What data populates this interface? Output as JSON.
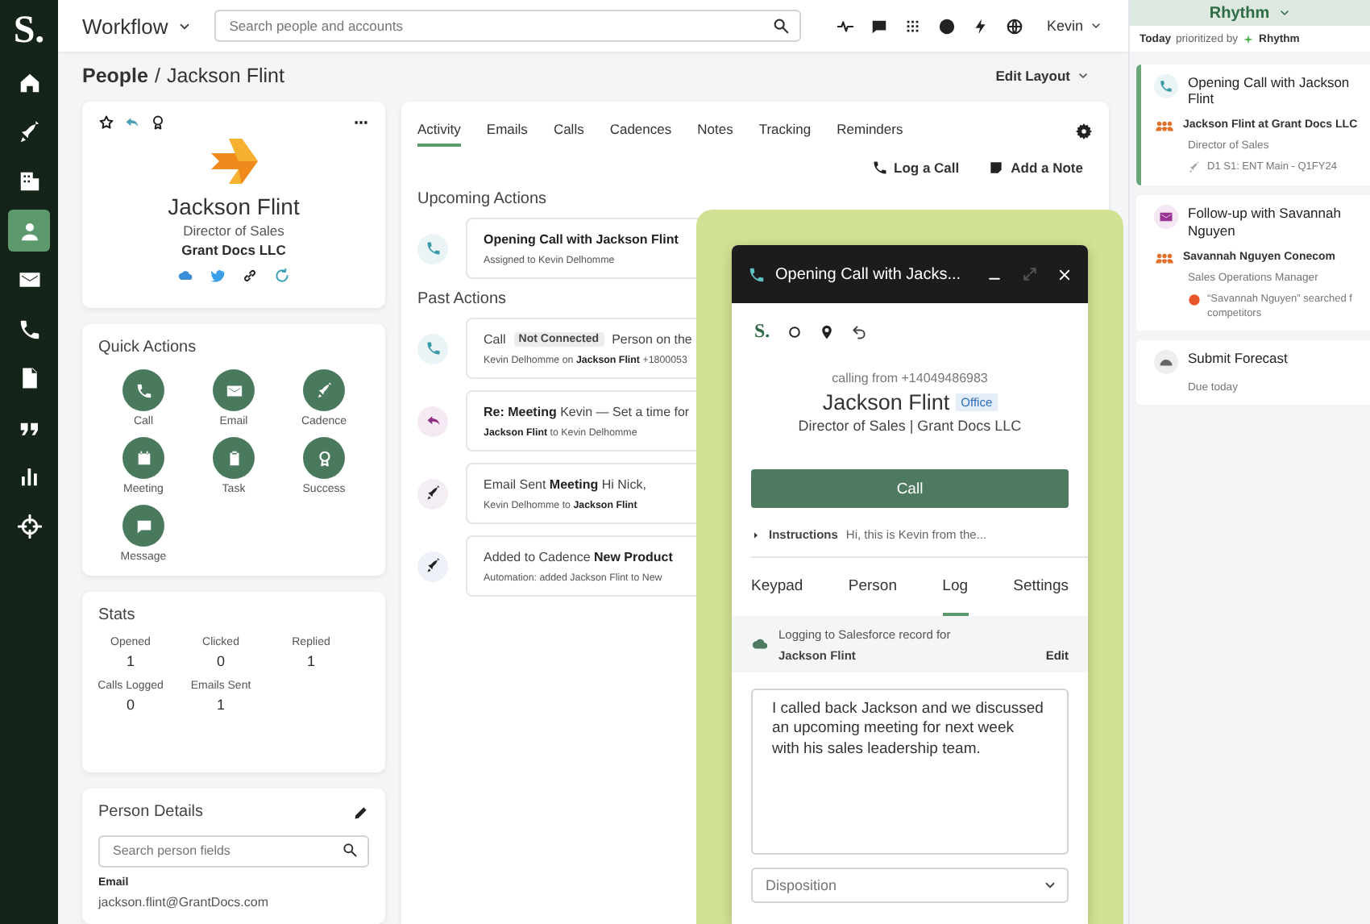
{
  "sidebar": {
    "logo": "S.",
    "items": [
      {
        "kind": "home",
        "selected": false
      },
      {
        "kind": "rocket",
        "selected": false
      },
      {
        "kind": "building",
        "selected": false
      },
      {
        "kind": "person",
        "selected": true
      },
      {
        "kind": "mail",
        "selected": false
      },
      {
        "kind": "phone",
        "selected": false
      },
      {
        "kind": "doc",
        "selected": false
      },
      {
        "kind": "quote",
        "selected": false
      },
      {
        "kind": "chart",
        "selected": false
      },
      {
        "kind": "target",
        "selected": false
      }
    ]
  },
  "topbar": {
    "title": "Workflow",
    "search": {
      "placeholder": "Search people and accounts"
    },
    "user": "Kevin"
  },
  "breadcrumb": {
    "section": "People",
    "separator": "/",
    "current": "Jackson Flint"
  },
  "edit_layout": "Edit Layout",
  "profile": {
    "name": "Jackson Flint",
    "title": "Director of Sales",
    "company": "Grant Docs LLC"
  },
  "quick_actions": {
    "title": "Quick Actions",
    "items": [
      {
        "kind": "phone",
        "label": "Call"
      },
      {
        "kind": "mail",
        "label": "Email"
      },
      {
        "kind": "rocket",
        "label": "Cadence"
      },
      {
        "kind": "calendar",
        "label": "Meeting"
      },
      {
        "kind": "clipboard",
        "label": "Task"
      },
      {
        "kind": "award",
        "label": "Success"
      },
      {
        "kind": "chat",
        "label": "Message"
      }
    ]
  },
  "stats": {
    "title": "Stats",
    "items": [
      {
        "label": "Opened",
        "value": "1"
      },
      {
        "label": "Clicked",
        "value": "0"
      },
      {
        "label": "Replied",
        "value": "1"
      },
      {
        "label": "Calls Logged",
        "value": "0"
      },
      {
        "label": "Emails Sent",
        "value": "1"
      }
    ]
  },
  "person_details": {
    "title": "Person Details",
    "search": {
      "placeholder": "Search person fields"
    },
    "field_label": "Email",
    "field_value": "jackson.flint@GrantDocs.com"
  },
  "activity": {
    "tabs": [
      {
        "label": "Activity",
        "selected": true
      },
      {
        "label": "Emails",
        "selected": false
      },
      {
        "label": "Calls",
        "selected": false
      },
      {
        "label": "Cadences",
        "selected": false
      },
      {
        "label": "Notes",
        "selected": false
      },
      {
        "label": "Tracking",
        "selected": false
      },
      {
        "label": "Reminders",
        "selected": false
      }
    ],
    "actions": [
      {
        "kind": "phone",
        "label": "Log a Call"
      },
      {
        "kind": "note",
        "label": "Add a Note"
      }
    ],
    "upcoming_title": "Upcoming Actions",
    "upcoming": [
      {
        "kind": "call",
        "heading": "**Opening Call with Jackson Flint**",
        "detail": "Assigned to Kevin Delhomme"
      }
    ],
    "past_title": "Past Actions",
    "past": [
      {
        "kind": "call",
        "heading": "Call",
        "tag": "Not Connected",
        "text": "Person on the",
        "detail": "Kevin Delhomme on **Jackson Flint** +1800053"
      },
      {
        "kind": "reply",
        "heading": "**Re: Meeting** Kevin — Set a time for",
        "detail": "**Jackson Flint** to Kevin Delhomme"
      },
      {
        "kind": "email",
        "heading": "Email Sent **Meeting** Hi Nick,",
        "detail": "Kevin Delhomme to **Jackson Flint**"
      },
      {
        "kind": "cadence",
        "heading": "Added to Cadence **New Product**",
        "detail": "Automation: added Jackson Flint to New"
      }
    ]
  },
  "dialer": {
    "logo": "S.",
    "title": "Opening Call with Jacks...",
    "calling_from": "calling from +14049486983",
    "name": "Jackson Flint",
    "badge": "Office",
    "subtitle": "Director of Sales | Grant Docs LLC",
    "call_button": "Call",
    "instructions_label": "Instructions",
    "instructions": "Hi, this is Kevin from the...",
    "tabs": [
      {
        "label": "Keypad",
        "selected": false
      },
      {
        "label": "Person",
        "selected": false
      },
      {
        "label": "Log",
        "selected": true
      },
      {
        "label": "Settings",
        "selected": false
      }
    ],
    "logging": "Logging to Salesforce record for",
    "logging_person": "Jackson Flint",
    "edit": "Edit",
    "notes": "I called back Jackson and we discussed an upcoming meeting for next week with his sales leadership team.",
    "disposition": {
      "placeholder": "Disposition"
    }
  },
  "rhythm": {
    "title": "Rhythm",
    "today": "Today",
    "prioritized": "prioritized by",
    "brand": "Rhythm",
    "cards": [
      {
        "kind": "call",
        "selected": true,
        "title": "Opening Call with Jackson Flint",
        "person": "Jackson Flint at Grant Docs LLC",
        "role": "Director of Sales",
        "meta": [
          "D1 S1: ENT Main - Q1FY24"
        ]
      },
      {
        "kind": "email",
        "selected": false,
        "title": "Follow-up with Savannah Nguyen",
        "person": "Savannah Nguyen Conecom",
        "role": "Sales Operations Manager",
        "meta": [
          "“Savannah Nguyen” searched f",
          "competitors"
        ]
      },
      {
        "kind": "forecast",
        "selected": false,
        "title": "Submit Forecast",
        "due": "Due today"
      }
    ]
  }
}
